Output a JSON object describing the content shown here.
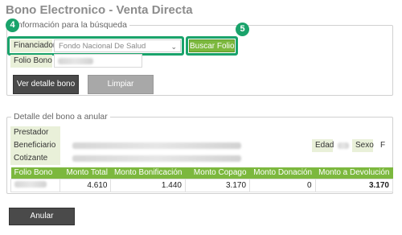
{
  "page": {
    "title": "Bono Electronico - Venta Directa"
  },
  "search_section": {
    "legend": "Información para la búsqueda",
    "financiador_label": "Financiador",
    "financiador_value": "Fondo Nacional De Salud",
    "folio_label": "Folio Bono",
    "buscar_label": "Buscar Folio",
    "ver_detalle_label": "Ver detalle bono",
    "limpiar_label": "Limpiar"
  },
  "annotations": {
    "step_a": "4",
    "step_b": "5",
    "accent_color": "#1aa36b"
  },
  "detail_section": {
    "legend": "Detalle del bono a anular",
    "prestador_label": "Prestador",
    "beneficiario_label": "Beneficiario",
    "cotizante_label": "Cotizante",
    "edad_label": "Edad",
    "sexo_label": "Sexo",
    "sexo_value": "F"
  },
  "table": {
    "headers": [
      "Folio Bono",
      "Monto Total",
      "Monto Bonificación",
      "Monto Copago",
      "Monto Donación",
      "Monto a Devolución"
    ],
    "row": {
      "monto_total": "4.610",
      "monto_bonificacion": "1.440",
      "monto_copago": "3.170",
      "monto_donacion": "0",
      "monto_devolucion": "3.170"
    }
  },
  "footer": {
    "anular_label": "Anular"
  },
  "colors": {
    "brand_green": "#7cb83e",
    "label_bg": "#e9f0d9",
    "dark_button": "#4a4a4a"
  }
}
